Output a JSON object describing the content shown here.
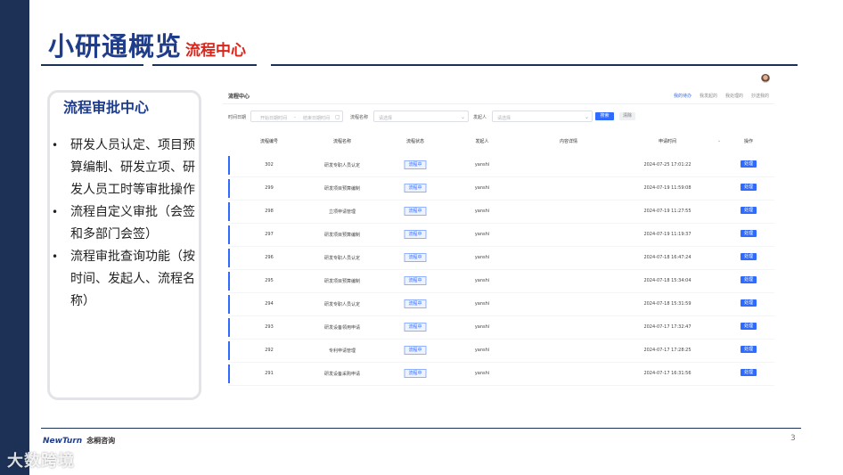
{
  "slide": {
    "title": "小研通概览",
    "subtitle": "流程中心",
    "page_number": "3",
    "brand_en": "NewTurn",
    "brand_cn": "念桐咨询",
    "watermark": "大数跨境"
  },
  "card": {
    "title": "流程审批中心",
    "bullets": [
      "研发人员认定、项目预算编制、研发立项、研发人员工时等审批操作",
      "流程自定义审批（会签和多部门会签）",
      "流程审批查询功能（按时间、发起人、流程名称）"
    ]
  },
  "app": {
    "title": "流程中心",
    "tabs": [
      "我的待办",
      "我发起的",
      "我处理的",
      "抄送我的"
    ],
    "filters": {
      "date_label": "时间日期",
      "start_placeholder": "开始日期时间",
      "separator": "-",
      "end_placeholder": "结束日期时间",
      "name_label": "流程名称",
      "name_placeholder": "请选择",
      "initiator_label": "发起人",
      "initiator_placeholder": "请选择",
      "search_label": "搜索",
      "reset_label": "清除"
    },
    "columns": [
      "流程编号",
      "流程名称",
      "流程状态",
      "发起人",
      "内容详情",
      "申请时间",
      "操作"
    ],
    "rows": [
      {
        "id": "302",
        "name": "研发专职人员认定",
        "status": "流程中",
        "initiator": "yanshi",
        "time": "2024-07-25 17:01:22",
        "action": "处理"
      },
      {
        "id": "299",
        "name": "研发项目预算编制",
        "status": "流程中",
        "initiator": "yanshi",
        "time": "2024-07-19 11:59:08",
        "action": "处理"
      },
      {
        "id": "298",
        "name": "立项申请管理",
        "status": "流程中",
        "initiator": "yanshi",
        "time": "2024-07-19 11:27:55",
        "action": "处理"
      },
      {
        "id": "297",
        "name": "研发项目预算编制",
        "status": "流程中",
        "initiator": "yanshi",
        "time": "2024-07-19 11:19:37",
        "action": "处理"
      },
      {
        "id": "296",
        "name": "研发专职人员认定",
        "status": "流程中",
        "initiator": "yanshi",
        "time": "2024-07-18 16:47:24",
        "action": "处理"
      },
      {
        "id": "295",
        "name": "研发项目预算编制",
        "status": "流程中",
        "initiator": "yanshi",
        "time": "2024-07-18 15:34:04",
        "action": "处理"
      },
      {
        "id": "294",
        "name": "研发专职人员认定",
        "status": "流程中",
        "initiator": "yanshi",
        "time": "2024-07-18 15:31:59",
        "action": "处理"
      },
      {
        "id": "293",
        "name": "研发设备领用申请",
        "status": "流程中",
        "initiator": "yanshi",
        "time": "2024-07-17 17:32:47",
        "action": "处理"
      },
      {
        "id": "292",
        "name": "专利申请管理",
        "status": "流程中",
        "initiator": "yanshi",
        "time": "2024-07-17 17:28:25",
        "action": "处理"
      },
      {
        "id": "291",
        "name": "研发设备采购申请",
        "status": "流程中",
        "initiator": "yanshi",
        "time": "2024-07-17 16:31:56",
        "action": "处理"
      }
    ]
  },
  "colors": {
    "navy": "#1d3156",
    "title_blue": "#1f3d8a",
    "accent_red": "#d9261c",
    "primary": "#2f6bff"
  }
}
